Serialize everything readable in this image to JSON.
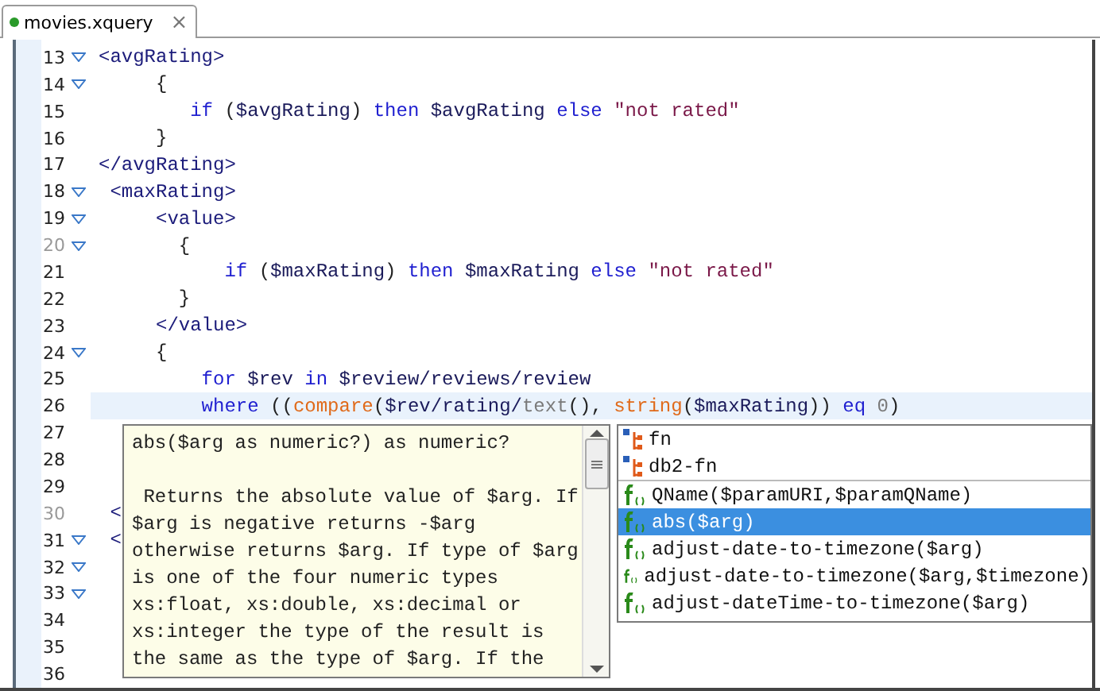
{
  "tab": {
    "title": "movies.xquery",
    "selected": true,
    "close": "×"
  },
  "lines": [
    {
      "number": "13",
      "fold": true,
      "muted": false,
      "current": false,
      "tokens": [
        {
          "kind": "tag",
          "text": "<avgRating>"
        }
      ]
    },
    {
      "number": "14",
      "fold": true,
      "muted": false,
      "current": false,
      "tokens": [
        {
          "kind": "plain",
          "text": "     {"
        }
      ]
    },
    {
      "number": "15",
      "fold": false,
      "muted": false,
      "current": false,
      "tokens": [
        {
          "kind": "keyword",
          "text": "        if"
        },
        {
          "kind": "plain",
          "text": " ("
        },
        {
          "kind": "var",
          "text": "$avgRating"
        },
        {
          "kind": "plain",
          "text": ") "
        },
        {
          "kind": "keyword",
          "text": "then"
        },
        {
          "kind": "var",
          "text": " $avgRating"
        },
        {
          "kind": "keyword",
          "text": " else"
        },
        {
          "kind": "string",
          "text": " \"not rated\""
        }
      ]
    },
    {
      "number": "16",
      "fold": false,
      "muted": false,
      "current": false,
      "tokens": [
        {
          "kind": "plain",
          "text": "     }"
        }
      ]
    },
    {
      "number": "17",
      "fold": false,
      "muted": false,
      "current": false,
      "tokens": [
        {
          "kind": "tag",
          "text": "</avgRating>"
        }
      ]
    },
    {
      "number": "18",
      "fold": true,
      "muted": false,
      "current": false,
      "tokens": [
        {
          "kind": "tag",
          "text": " <maxRating>"
        }
      ]
    },
    {
      "number": "19",
      "fold": true,
      "muted": false,
      "current": false,
      "tokens": [
        {
          "kind": "tag",
          "text": "     <value>"
        }
      ]
    },
    {
      "number": "20",
      "fold": true,
      "muted": true,
      "current": false,
      "tokens": [
        {
          "kind": "plain",
          "text": "       {"
        }
      ]
    },
    {
      "number": "21",
      "fold": false,
      "muted": false,
      "current": false,
      "tokens": [
        {
          "kind": "keyword",
          "text": "           if"
        },
        {
          "kind": "plain",
          "text": " ("
        },
        {
          "kind": "var",
          "text": "$maxRating"
        },
        {
          "kind": "plain",
          "text": ") "
        },
        {
          "kind": "keyword",
          "text": "then"
        },
        {
          "kind": "var",
          "text": " $maxRating"
        },
        {
          "kind": "keyword",
          "text": " else"
        },
        {
          "kind": "string",
          "text": " \"not rated\""
        }
      ]
    },
    {
      "number": "22",
      "fold": false,
      "muted": false,
      "current": false,
      "tokens": [
        {
          "kind": "plain",
          "text": "       }"
        }
      ]
    },
    {
      "number": "23",
      "fold": false,
      "muted": false,
      "current": false,
      "tokens": [
        {
          "kind": "tag",
          "text": "     </value>"
        }
      ]
    },
    {
      "number": "24",
      "fold": true,
      "muted": false,
      "current": false,
      "tokens": [
        {
          "kind": "plain",
          "text": "     {"
        }
      ]
    },
    {
      "number": "25",
      "fold": false,
      "muted": false,
      "current": false,
      "tokens": [
        {
          "kind": "keyword",
          "text": "         for"
        },
        {
          "kind": "var",
          "text": " $rev"
        },
        {
          "kind": "keyword",
          "text": " in"
        },
        {
          "kind": "var",
          "text": " $review/reviews/review"
        }
      ]
    },
    {
      "number": "26",
      "fold": false,
      "muted": false,
      "current": true,
      "tokens": [
        {
          "kind": "keyword",
          "text": "         where"
        },
        {
          "kind": "plain",
          "text": " (("
        },
        {
          "kind": "function",
          "text": "compare"
        },
        {
          "kind": "plain",
          "text": "("
        },
        {
          "kind": "var",
          "text": "$rev/rating/"
        },
        {
          "kind": "number",
          "text": "text"
        },
        {
          "kind": "plain",
          "text": "(), "
        },
        {
          "kind": "function",
          "text": "string"
        },
        {
          "kind": "plain",
          "text": "("
        },
        {
          "kind": "var",
          "text": "$maxRating"
        },
        {
          "kind": "plain",
          "text": ")) "
        },
        {
          "kind": "keyword",
          "text": "eq"
        },
        {
          "kind": "number",
          "text": " 0"
        },
        {
          "kind": "plain",
          "text": ")"
        }
      ]
    },
    {
      "number": "27",
      "fold": false,
      "muted": false,
      "current": false
    },
    {
      "number": "28",
      "fold": false,
      "muted": false,
      "current": false
    },
    {
      "number": "29",
      "fold": false,
      "muted": false,
      "current": false
    },
    {
      "number": "30",
      "fold": false,
      "muted": true,
      "current": false,
      "tokens": [
        {
          "kind": "tag",
          "text": " <"
        }
      ]
    },
    {
      "number": "31",
      "fold": true,
      "muted": false,
      "current": false,
      "tokens": [
        {
          "kind": "tag",
          "text": " <"
        }
      ]
    },
    {
      "number": "32",
      "fold": true,
      "muted": false,
      "current": false
    },
    {
      "number": "33",
      "fold": true,
      "muted": false,
      "current": false
    },
    {
      "number": "34",
      "fold": false,
      "muted": false,
      "current": false
    },
    {
      "number": "35",
      "fold": false,
      "muted": false,
      "current": false
    },
    {
      "number": "36",
      "fold": false,
      "muted": false,
      "current": false
    }
  ],
  "documentation": {
    "signature": "abs($arg as numeric?) as numeric?",
    "description_lines": [
      " Returns the absolute value of $arg. If",
      "$arg is negative returns -$arg",
      "otherwise returns $arg. If type of $arg",
      "is one of the four numeric types",
      "xs:float, xs:double, xs:decimal or",
      "xs:integer the type of the result is",
      "the same as the type of $arg. If the"
    ]
  },
  "completions": [
    {
      "kind": "namespace",
      "label": "fn",
      "selected": false
    },
    {
      "kind": "namespace",
      "label": "db2-fn",
      "selected": false
    },
    {
      "kind": "function",
      "label": "QName($paramURI,$paramQName)",
      "selected": false
    },
    {
      "kind": "function",
      "label": "abs($arg)",
      "selected": true
    },
    {
      "kind": "function",
      "label": "adjust-date-to-timezone($arg)",
      "selected": false
    },
    {
      "kind": "function",
      "label": "adjust-date-to-timezone($arg,$timezone)",
      "selected": false
    },
    {
      "kind": "function",
      "label": "adjust-dateTime-to-timezone($arg)",
      "selected": false
    }
  ]
}
